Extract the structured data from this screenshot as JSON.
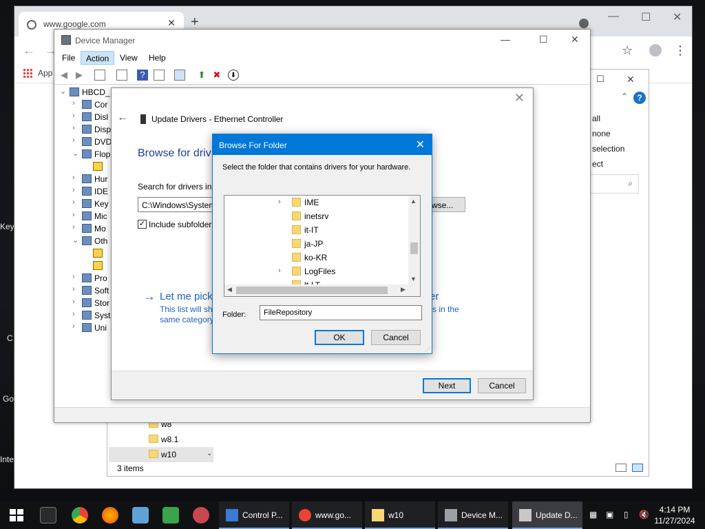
{
  "browser": {
    "tab_title": "www.google.com",
    "bookmarks_label": "App"
  },
  "desktop": {
    "labels": [
      "Key",
      "C",
      "Go",
      "Inte"
    ]
  },
  "explorer": {
    "right_panel": [
      "all",
      "none",
      "selection",
      "ect"
    ],
    "list_items": [
      "w8",
      "w8.1",
      "w10"
    ],
    "status": "3 items",
    "help_icon": "?"
  },
  "device_manager": {
    "title": "Device Manager",
    "menu": [
      "File",
      "Action",
      "View",
      "Help"
    ],
    "tree": [
      {
        "label": "HBCD_",
        "expander": "collapse"
      },
      {
        "label": "Cor",
        "expander": "expand"
      },
      {
        "label": "Disl",
        "expander": "expand"
      },
      {
        "label": "Disp",
        "expander": "expand"
      },
      {
        "label": "DVD",
        "expander": "expand"
      },
      {
        "label": "Flop",
        "expander": "collapse"
      },
      {
        "label": "",
        "expander": "none",
        "warning": true
      },
      {
        "label": "Hur",
        "expander": "expand"
      },
      {
        "label": "IDE",
        "expander": "expand"
      },
      {
        "label": "Key",
        "expander": "expand"
      },
      {
        "label": "Mic",
        "expander": "expand"
      },
      {
        "label": "Mo",
        "expander": "expand"
      },
      {
        "label": "Oth",
        "expander": "collapse"
      },
      {
        "label": "",
        "expander": "none",
        "warning": true
      },
      {
        "label": "",
        "expander": "none",
        "warning": true
      },
      {
        "label": "Pro",
        "expander": "expand"
      },
      {
        "label": "Soft",
        "expander": "expand"
      },
      {
        "label": "Stor",
        "expander": "expand"
      },
      {
        "label": "Syst",
        "expander": "expand"
      },
      {
        "label": "Uni",
        "expander": "expand"
      }
    ]
  },
  "update_drivers": {
    "title": "Update Drivers - Ethernet Controller",
    "heading": "Browse for driv",
    "search_label": "Search for drivers in t",
    "path_value": "C:\\Windows\\System",
    "browse_label": "wse...",
    "include_subfolders": "Include subfolder",
    "include_checked": true,
    "pick_title": "Let me pick",
    "pick_desc_1": "This list will sh",
    "pick_desc_2": "same category",
    "pick_title_tail": "er",
    "pick_desc_tail": "rs in the",
    "next_label": "Next",
    "cancel_label": "Cancel"
  },
  "browse_folder": {
    "title": "Browse For Folder",
    "description": "Select the folder that contains drivers for your hardware.",
    "folders": [
      {
        "name": "IME",
        "expandable": true
      },
      {
        "name": "inetsrv",
        "expandable": false
      },
      {
        "name": "it-IT",
        "expandable": false
      },
      {
        "name": "ja-JP",
        "expandable": false
      },
      {
        "name": "ko-KR",
        "expandable": false
      },
      {
        "name": "LogFiles",
        "expandable": true
      },
      {
        "name": "lt-LT",
        "expandable": false
      }
    ],
    "folder_label": "Folder:",
    "folder_value": "FileRepository",
    "ok_label": "OK",
    "cancel_label": "Cancel"
  },
  "taskbar": {
    "tasks": [
      {
        "label": "Control P...",
        "icon": "control-panel-icon"
      },
      {
        "label": "www.go...",
        "icon": "chrome-icon"
      },
      {
        "label": "w10",
        "icon": "folder-icon"
      },
      {
        "label": "Device M...",
        "icon": "device-manager-icon"
      },
      {
        "label": "Update D...",
        "icon": "update-driver-icon"
      }
    ],
    "time": "4:14 PM",
    "date": "11/27/2024"
  },
  "colors": {
    "accent": "#0078d7",
    "link": "#1c62b9",
    "heading": "#1c3f94"
  }
}
